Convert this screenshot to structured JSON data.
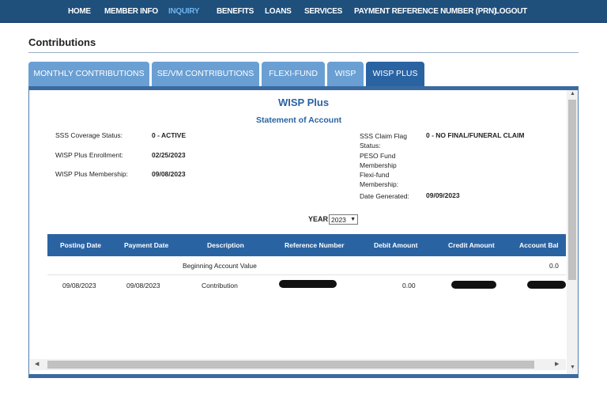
{
  "nav": [
    "HOME",
    "MEMBER INFO",
    "INQUIRY",
    "BENEFITS",
    "LOANS",
    "SERVICES",
    "PAYMENT REFERENCE NUMBER (PRN)",
    "LOGOUT"
  ],
  "nav_active": "INQUIRY",
  "page_title": "Contributions",
  "tabs": [
    "MONTHLY CONTRIBUTIONS",
    "SE/VM CONTRIBUTIONS",
    "FLEXI-FUND",
    "WISP",
    "WISP PLUS"
  ],
  "active_tab": "WISP PLUS",
  "soa": {
    "title": "WISP Plus",
    "subtitle": "Statement of Account",
    "left_fields": [
      {
        "label": "SSS Coverage Status:",
        "value": "0 - ACTIVE"
      },
      {
        "label": "WISP Plus Enrollment:",
        "value": "02/25/2023"
      },
      {
        "label": "WISP Plus Membership:",
        "value": "09/08/2023"
      }
    ],
    "right_fields": {
      "claim_flag_label": "SSS Claim Flag Status:",
      "claim_flag_value": "0 - NO FINAL/FUNERAL CLAIM",
      "peso_label": "PESO Fund Membership",
      "flexi_label": "Flexi-fund Membership:",
      "date_label": "Date Generated:",
      "date_value": "09/09/2023"
    },
    "year_label": "YEAR",
    "year_value": "2023"
  },
  "table": {
    "headers": [
      "Posting Date",
      "Payment Date",
      "Description",
      "Reference Number",
      "Debit Amount",
      "Credit Amount",
      "Account Bal"
    ],
    "beginning": {
      "description": "Beginning Account Value",
      "balance": "0.0"
    },
    "rows": [
      {
        "posting_date": "09/08/2023",
        "payment_date": "09/08/2023",
        "description": "Contribution",
        "debit": "0.00"
      }
    ]
  },
  "colors": {
    "nav_bg": "#1f4f7b",
    "nav_active": "#6fb3ee",
    "tab": "#6a9fd3",
    "tab_active": "#2a63a2",
    "accent": "#2a63a2"
  },
  "icons": {
    "year_dropdown": "chevron-down-icon",
    "scroll": [
      "scroll-left-icon",
      "scroll-right-icon",
      "scroll-up-icon",
      "scroll-down-icon"
    ]
  }
}
